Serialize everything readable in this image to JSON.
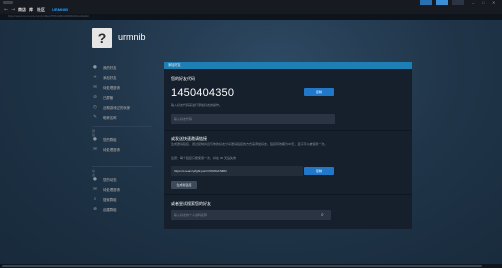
{
  "topbar": {
    "menu": [
      "商店",
      "库",
      "社区",
      "URMNIB"
    ],
    "url": "https://steamcommunity.com/profiles/76561198410669622/friends/add"
  },
  "profile": {
    "avatar_glyph": "?",
    "username": "urmnib"
  },
  "sidebar": {
    "group1": [
      {
        "label": "我的好友",
        "icon": "person"
      },
      {
        "label": "添加好友",
        "icon": "person-add"
      },
      {
        "label": "待处理邀请",
        "icon": "invite"
      },
      {
        "label": "已屏蔽",
        "icon": "block"
      },
      {
        "label": "近期游戏过的玩家",
        "icon": "recent"
      },
      {
        "label": "昵称名称",
        "icon": "tag"
      }
    ],
    "group2_title": "群组",
    "group2": [
      {
        "label": "您的群组",
        "icon": "group"
      },
      {
        "label": "待处理邀请",
        "icon": "invite"
      }
    ],
    "group3_title": "动态",
    "group3": [
      {
        "label": "您的动态",
        "icon": "activity"
      },
      {
        "label": "待处理邀请",
        "icon": "invite"
      },
      {
        "label": "搜索群组",
        "icon": "search"
      },
      {
        "label": "创建群组",
        "icon": "plus"
      }
    ]
  },
  "panel": {
    "header": "添加好友",
    "friend_code": {
      "title": "您的好友代码",
      "code": "1450404350",
      "copy_button": "复制",
      "hint": "输入好友代码来进行添加好友的操作。",
      "input_placeholder": "输入好友代码"
    },
    "quick_invite": {
      "title": "或发送快速邀请链接",
      "desc": "生成邀请链接，通过复制并且与你的好友分享邀请链接的方式来添加好友，链接有效期为30天，且只可以被使用一次。",
      "note": "注意：每个链接只能使用一次，并在 30 天后失效",
      "link": "https://s.team/p/fgbf-pwrr/VWWGFNBM",
      "copy_button": "复制",
      "new_link_button": "生成新链接"
    },
    "search": {
      "title": "或者尝试搜索您的好友",
      "placeholder": "输入好友的个人资料名称"
    }
  }
}
